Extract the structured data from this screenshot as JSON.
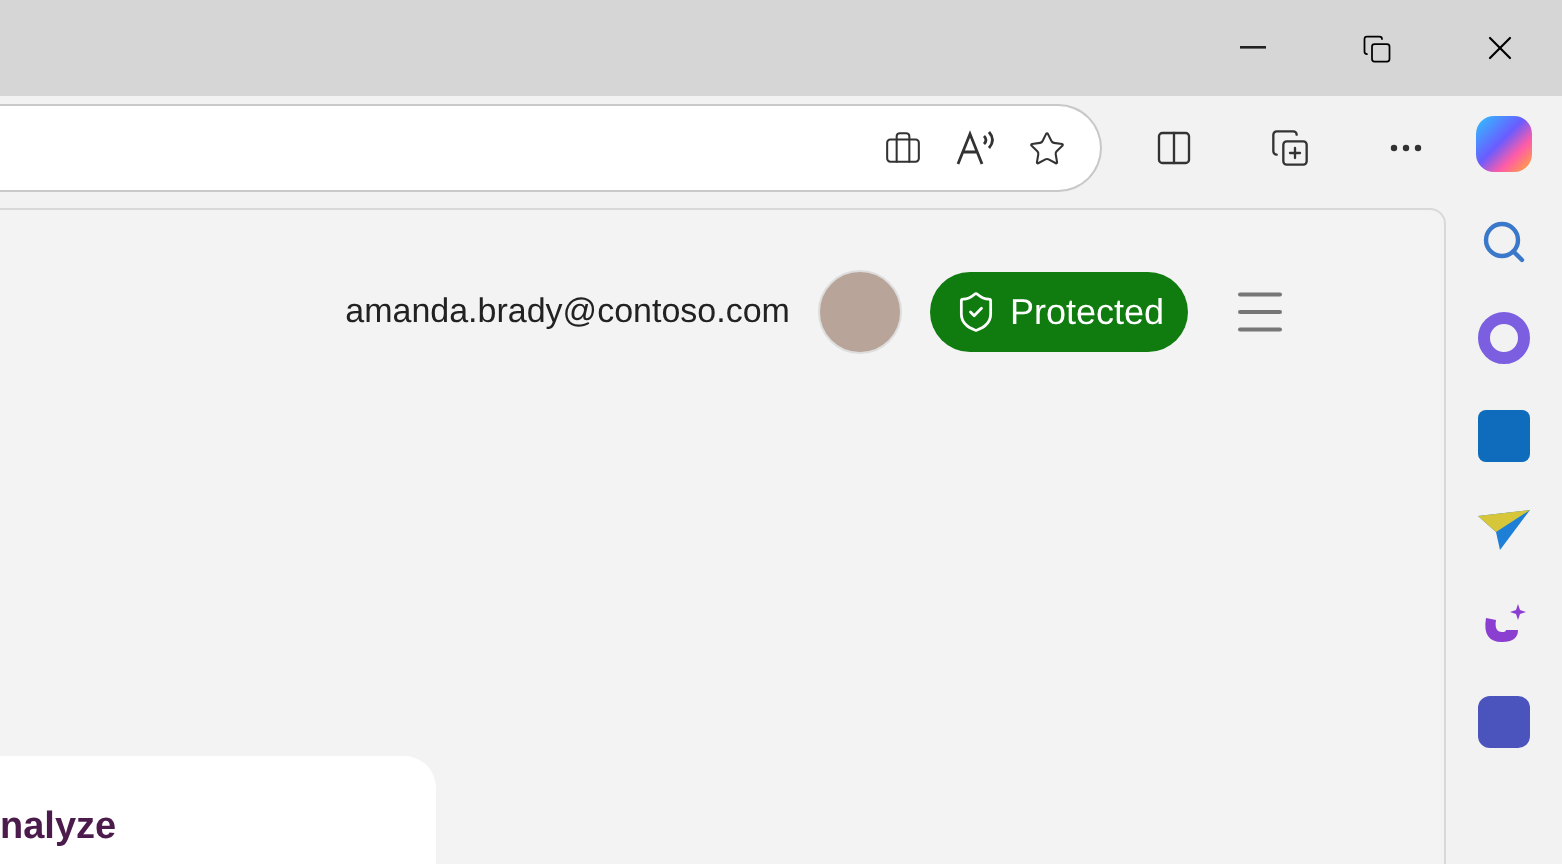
{
  "account": {
    "email": "amanda.brady@contoso.com"
  },
  "status_badge": {
    "label": "Protected"
  },
  "card": {
    "heading": "nalyze"
  }
}
